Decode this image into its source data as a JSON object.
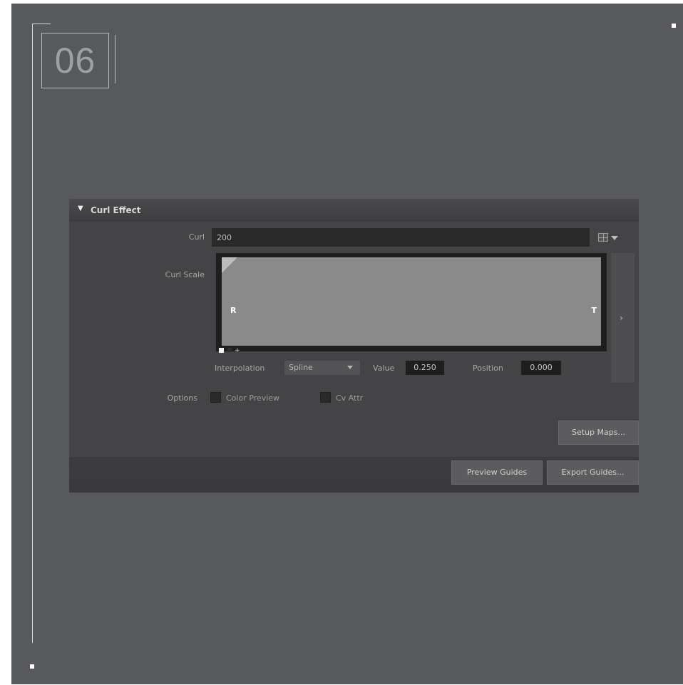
{
  "slide": {
    "number": "06"
  },
  "panel": {
    "title": "Curl Effect",
    "curl": {
      "label": "Curl",
      "value": "200"
    },
    "curl_scale": {
      "label": "Curl Scale",
      "left_marker": "R",
      "right_marker": "T",
      "key_marker": "+"
    },
    "interpolation": {
      "label": "Interpolation",
      "value": "Spline"
    },
    "value": {
      "label": "Value",
      "value": "0.250"
    },
    "position": {
      "label": "Position",
      "value": "0.000"
    },
    "options": {
      "label": "Options",
      "items": [
        {
          "label": "Color Preview",
          "checked": false
        },
        {
          "label": "Cv Attr",
          "checked": false
        }
      ]
    },
    "buttons": {
      "setup_maps": "Setup Maps...",
      "preview_guides": "Preview Guides",
      "export_guides": "Export Guides..."
    }
  },
  "colors": {
    "background": "#58595d",
    "panel": "#444446",
    "field": "#1e1e1f",
    "ramp": "#8a8a8b"
  }
}
